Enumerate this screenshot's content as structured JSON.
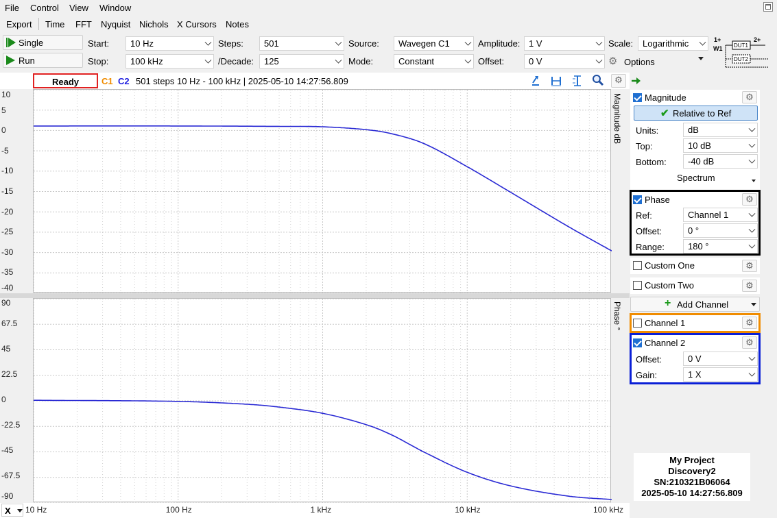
{
  "menu": [
    "File",
    "Control",
    "View",
    "Window"
  ],
  "tabs": [
    "Export",
    "Time",
    "FFT",
    "Nyquist",
    "Nichols",
    "X Cursors",
    "Notes"
  ],
  "toolbar": {
    "single_label": "Single",
    "run_label": "Run",
    "start_label": "Start:",
    "start_value": "10 Hz",
    "stop_label": "Stop:",
    "stop_value": "100 kHz",
    "steps_label": "Steps:",
    "steps_value": "501",
    "decade_label": "/Decade:",
    "decade_value": "125",
    "source_label": "Source:",
    "source_value": "Wavegen C1",
    "mode_label": "Mode:",
    "mode_value": "Constant",
    "amplitude_label": "Amplitude:",
    "amplitude_value": "1 V",
    "offset_label": "Offset:",
    "offset_value": "0 V",
    "scale_label": "Scale:",
    "scale_value": "Logarithmic",
    "options_label": "Options",
    "diagram": {
      "in_label": "1+",
      "w_label": "W1",
      "out_label": "2+",
      "dut1": "DUT1",
      "dut2": "DUT2"
    }
  },
  "status": {
    "state": "Ready",
    "c1": "C1",
    "c2": "C2",
    "info": "501 steps  10 Hz - 100 kHz | 2025-05-10 14:27:56.809"
  },
  "magnitude_plot": {
    "y_ticks": [
      "10",
      "5",
      "0",
      "-5",
      "-10",
      "-15",
      "-20",
      "-25",
      "-30",
      "-35",
      "-40"
    ],
    "axis_title": "Magnitude  dB"
  },
  "phase_plot": {
    "y_ticks": [
      "90",
      "67.5",
      "45",
      "22.5",
      "0",
      "-22.5",
      "-45",
      "-67.5",
      "-90"
    ],
    "axis_title": "Phase  °"
  },
  "x_axis": {
    "selector": "X",
    "ticks": [
      "10 Hz",
      "100 Hz",
      "1 kHz",
      "10 kHz",
      "100 kHz"
    ]
  },
  "chart_data": [
    {
      "type": "line",
      "xscale": "log",
      "xlim": [
        10,
        100000
      ],
      "ylim": [
        -40,
        10
      ],
      "ylabel": "Magnitude  dB",
      "series": [
        {
          "color": "#2a2ad4",
          "x": [
            10,
            100,
            500,
            1000,
            2000,
            3000,
            5000,
            10000,
            20000,
            50000,
            100000
          ],
          "y": [
            1.1,
            1.1,
            1.0,
            0.9,
            0.2,
            -0.8,
            -3.2,
            -8.9,
            -15.2,
            -23.6,
            -29.6
          ]
        }
      ]
    },
    {
      "type": "line",
      "xscale": "log",
      "xlim": [
        10,
        100000
      ],
      "ylim": [
        -90,
        90
      ],
      "ylabel": "Phase  °",
      "series": [
        {
          "color": "#2a2ad4",
          "x": [
            10,
            100,
            300,
            500,
            1000,
            2000,
            3000,
            5000,
            10000,
            20000,
            50000,
            100000
          ],
          "y": [
            0.5,
            -0.5,
            -3,
            -5.5,
            -11,
            -21,
            -30,
            -45,
            -63,
            -75,
            -84,
            -87
          ]
        }
      ]
    }
  ],
  "side": {
    "magnitude": {
      "label": "Magnitude",
      "checked": true,
      "relative_btn": "Relative to Ref",
      "units_label": "Units:",
      "units_value": "dB",
      "top_label": "Top:",
      "top_value": "10 dB",
      "bottom_label": "Bottom:",
      "bottom_value": "-40 dB",
      "spectrum_label": "Spectrum"
    },
    "phase": {
      "label": "Phase",
      "checked": true,
      "ref_label": "Ref:",
      "ref_value": "Channel 1",
      "offset_label": "Offset:",
      "offset_value": "0 °",
      "range_label": "Range:",
      "range_value": "180 °"
    },
    "custom_one": "Custom One",
    "custom_two": "Custom Two",
    "add_channel": "Add Channel",
    "channel1": "Channel 1",
    "channel2": {
      "label": "Channel 2",
      "offset_label": "Offset:",
      "offset_value": "0 V",
      "gain_label": "Gain:",
      "gain_value": "1 X"
    },
    "info": [
      "My Project",
      "Discovery2",
      "SN:210321B06064",
      "2025-05-10 14:27:56.809"
    ]
  },
  "colors": {
    "c1": "#f08c00",
    "c2": "#2020e0",
    "trace": "#2a2ad4",
    "ready_border": "#e02020",
    "phase_box": "#000000",
    "ch1_box": "#f08c00",
    "ch2_box": "#0a1fd6"
  }
}
